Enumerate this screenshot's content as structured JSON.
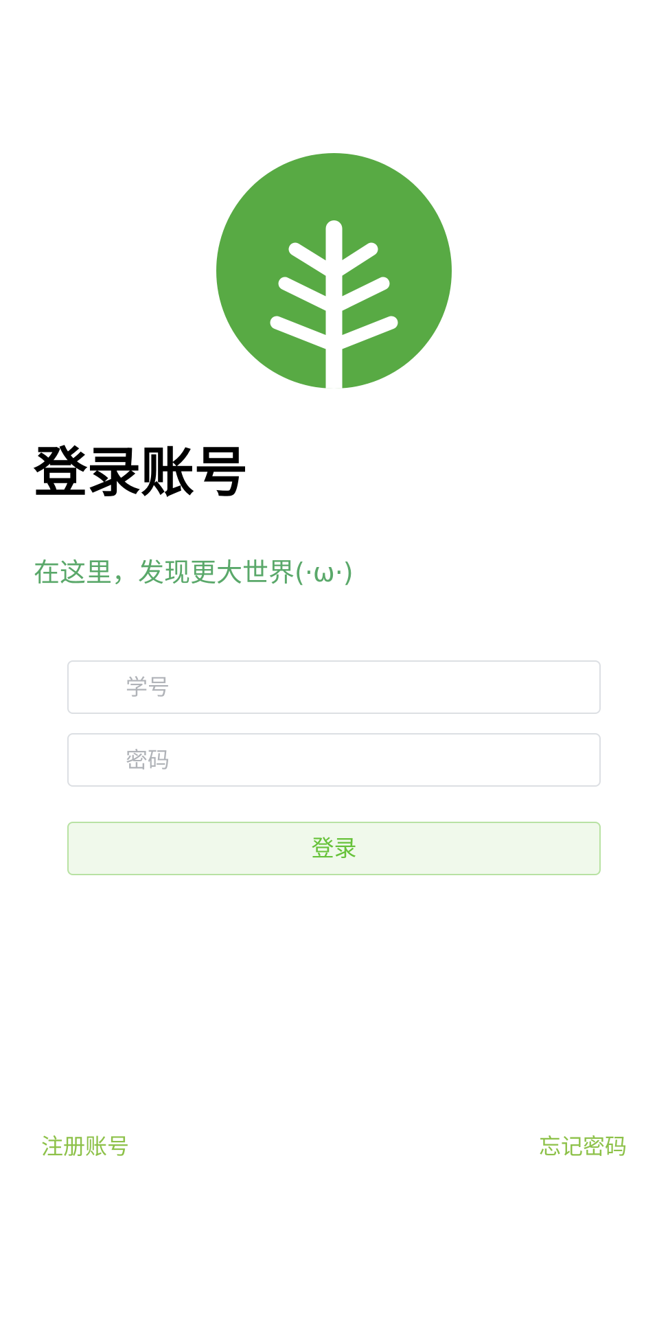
{
  "brand": {
    "logo_icon": "tree-sprout-icon",
    "logo_color": "#58aa44"
  },
  "header": {
    "title": "登录账号",
    "subtitle": "在这里，发现更大世界(·ω·)"
  },
  "form": {
    "username": {
      "value": "",
      "placeholder": "学号"
    },
    "password": {
      "value": "",
      "placeholder": "密码"
    },
    "login_label": "登录"
  },
  "footer": {
    "register_label": "注册账号",
    "forgot_label": "忘记密码"
  },
  "colors": {
    "accent": "#67c23a",
    "subtitle": "#5aa86a",
    "link": "#8dc149"
  }
}
